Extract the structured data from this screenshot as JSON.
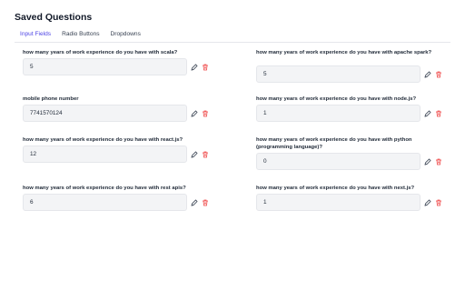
{
  "page": {
    "title": "Saved Questions"
  },
  "tabs": [
    {
      "label": "Input Fields",
      "active": true
    },
    {
      "label": "Radio Buttons",
      "active": false
    },
    {
      "label": "Dropdowns",
      "active": false
    }
  ],
  "colors": {
    "accent": "#4f46e5",
    "delete": "#ef4444",
    "edit": "#374151",
    "input_bg": "#f3f4f6"
  },
  "icons": {
    "edit": "pencil-icon",
    "delete": "trash-icon"
  },
  "questions": [
    {
      "label": "how many years of work experience do you have with scala?",
      "value": "5"
    },
    {
      "label": "how many years of work experience do you have with apache spark?",
      "value": "5"
    },
    {
      "label": "mobile phone number",
      "value": "7741570124"
    },
    {
      "label": "how many years of work experience do you have with node.js?",
      "value": "1"
    },
    {
      "label": "how many years of work experience do you have with react.js?",
      "value": "12"
    },
    {
      "label": "how many years of work experience do you have with python (programming language)?",
      "value": "0"
    },
    {
      "label": "how many years of work experience do you have with rest apis?",
      "value": "6"
    },
    {
      "label": "how many years of work experience do you have with next.js?",
      "value": "1"
    }
  ]
}
